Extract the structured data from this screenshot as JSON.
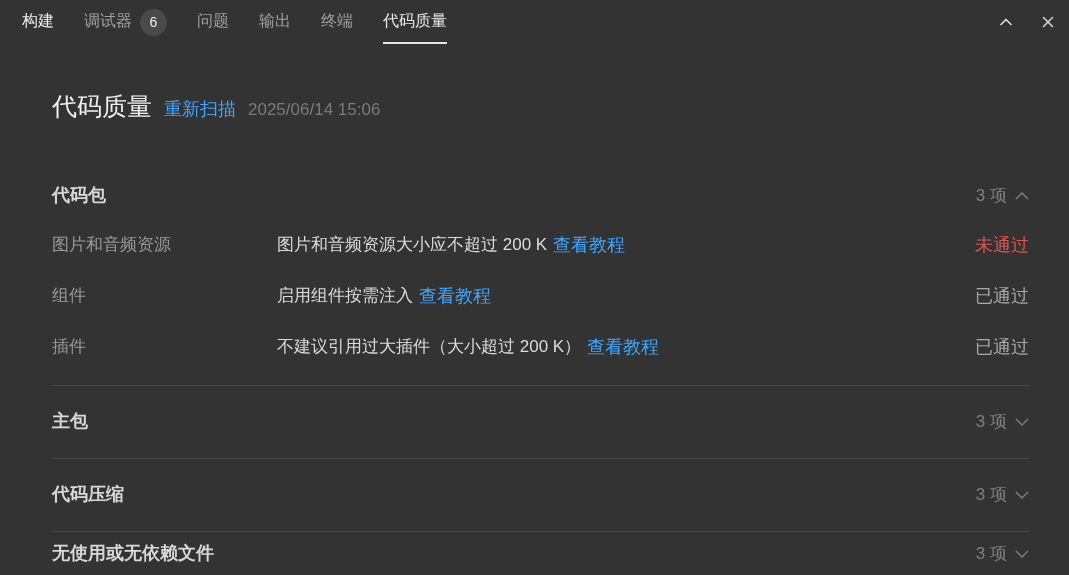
{
  "tabs": [
    {
      "label": "构建",
      "selected": false,
      "hovered": true
    },
    {
      "label": "调试器",
      "selected": false,
      "hovered": false,
      "badge": "6"
    },
    {
      "label": "问题",
      "selected": false,
      "hovered": false
    },
    {
      "label": "输出",
      "selected": false,
      "hovered": false
    },
    {
      "label": "终端",
      "selected": false,
      "hovered": false
    },
    {
      "label": "代码质量",
      "selected": true,
      "hovered": false
    }
  ],
  "header": {
    "title": "代码质量",
    "rescan": "重新扫描",
    "timestamp": "2025/06/14 15:06"
  },
  "sections": [
    {
      "title": "代码包",
      "count": "3 项",
      "expanded": true,
      "rows": [
        {
          "name": "图片和音频资源",
          "description": "图片和音频资源大小应不超过 200 K",
          "link": "查看教程",
          "status": "未通过",
          "passed": false
        },
        {
          "name": "组件",
          "description": "启用组件按需注入",
          "link": "查看教程",
          "status": "已通过",
          "passed": true
        },
        {
          "name": "插件",
          "description": "不建议引用过大插件（大小超过 200 K）",
          "link": "查看教程",
          "status": "已通过",
          "passed": true
        }
      ]
    },
    {
      "title": "主包",
      "count": "3 项",
      "expanded": false
    },
    {
      "title": "代码压缩",
      "count": "3 项",
      "expanded": false
    },
    {
      "title": "无使用或无依赖文件",
      "count": "3 项",
      "expanded": false
    }
  ]
}
